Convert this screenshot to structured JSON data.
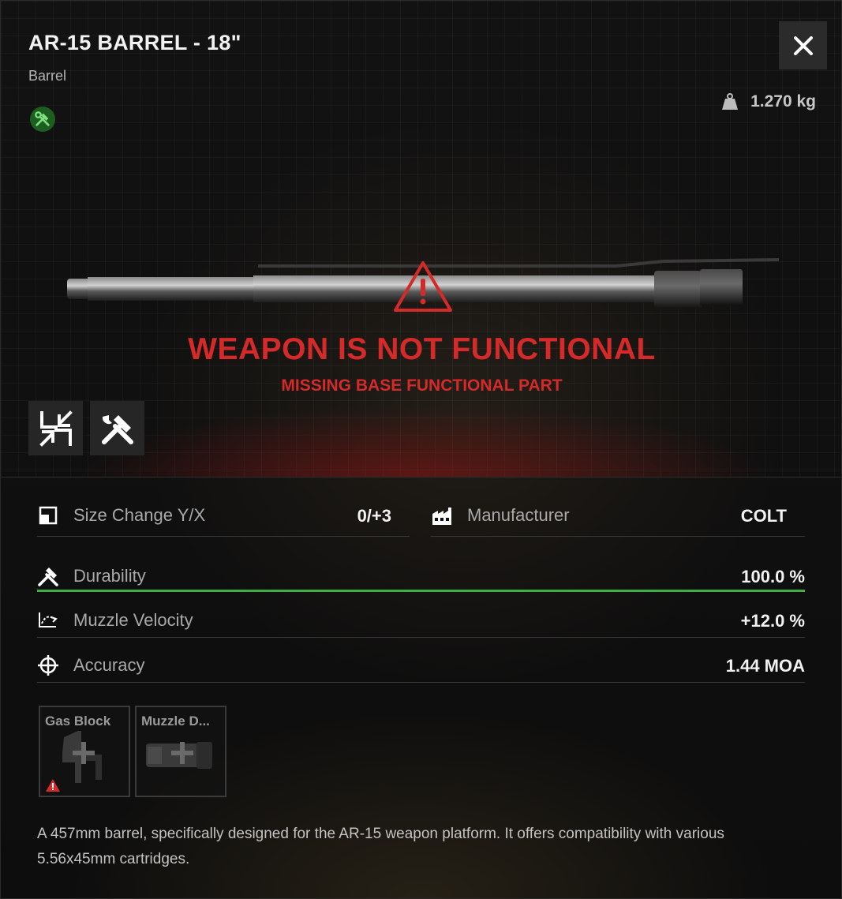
{
  "item": {
    "title": "AR-15 BARREL - 18\"",
    "category": "Barrel",
    "weight": "1.270 kg",
    "description": "A 457mm barrel, specifically designed for the AR-15 weapon platform. It offers compatibility with various 5.56x45mm cartridges."
  },
  "warning": {
    "title": "WEAPON IS NOT FUNCTIONAL",
    "subtitle": "MISSING BASE FUNCTIONAL PART"
  },
  "stats": {
    "size_change": {
      "label": "Size Change Y/X",
      "value": "0/+3",
      "icon": "size-change-icon"
    },
    "manufacturer": {
      "label": "Manufacturer",
      "value": "COLT",
      "icon": "factory-icon"
    },
    "durability": {
      "label": "Durability",
      "value": "100.0 %",
      "fraction": 1.0,
      "icon": "tools-icon"
    },
    "muzzle_velocity": {
      "label": "Muzzle Velocity",
      "value": "+12.0 %",
      "icon": "velocity-icon"
    },
    "accuracy": {
      "label": "Accuracy",
      "value": "1.44 MOA",
      "icon": "crosshair-icon"
    }
  },
  "slots": [
    {
      "label": "Gas Block",
      "warning": true
    },
    {
      "label": "Muzzle D...",
      "warning": false
    }
  ],
  "colors": {
    "warning_red": "#d52a2a",
    "durability_green": "#3fae43",
    "tool_badge_green": "#1c5e1f"
  }
}
